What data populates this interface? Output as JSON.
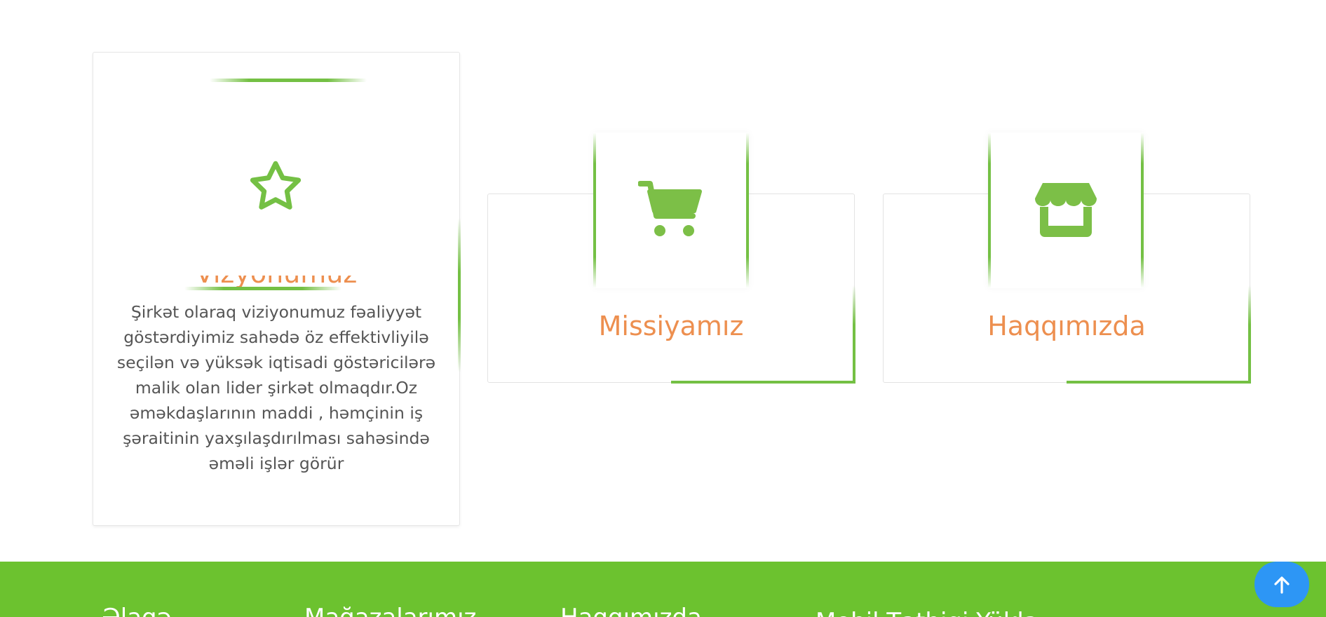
{
  "vision_card": {
    "title": "Vizyonumuz",
    "icon": "star-icon",
    "description": "Şirkət olaraq viziyonumuz fəaliyyət göstərdiyimiz sahədə öz effektivliyilə seçilən və yüksək iqtisadi göstəricilərə malik olan lider şirkət olmaqdır.Oz əməkdaşlarının maddi , həmçinin iş şəraitinin yaxşılaşdırılması sahəsində əməli işlər görür"
  },
  "mission_card": {
    "title": "Missiyamız",
    "icon": "shopping-cart-icon"
  },
  "about_card": {
    "title": "Haqqımızda",
    "icon": "store-icon"
  },
  "footer": {
    "contact_heading": "Əlaqə",
    "stores_heading": "Mağazalarımız",
    "about_heading": "Haqqımızda",
    "app_heading": "Mobil Tətbiqi Yüklə"
  },
  "scroll_top": {
    "icon": "arrow-up-icon"
  },
  "colors": {
    "accent_green": "#74c044",
    "title_orange": "#ed8f4f",
    "footer_green": "#6cc22f",
    "scroll_blue": "#2d96f5"
  }
}
